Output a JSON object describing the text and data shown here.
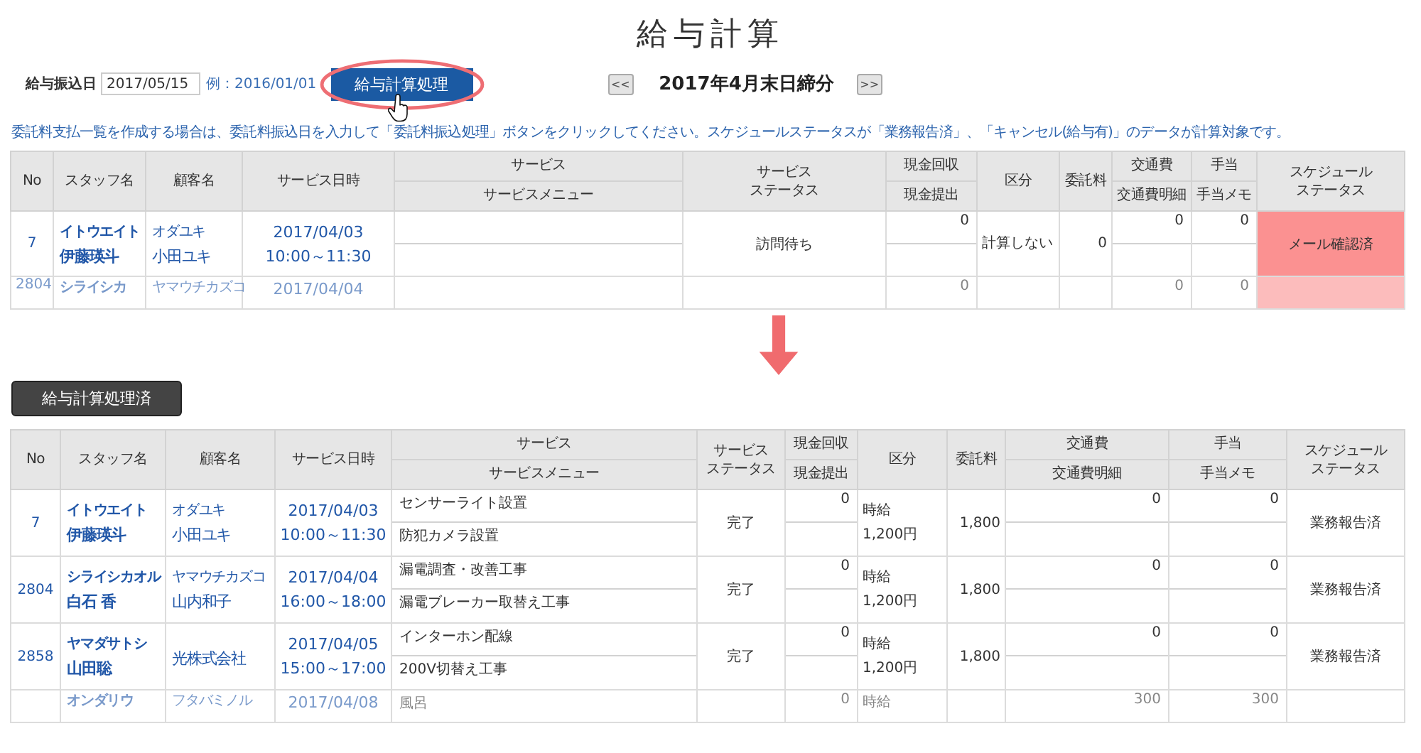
{
  "page_title": "給与計算",
  "payment_date": {
    "label": "給与振込日",
    "value": "2017/05/15",
    "hint": "例：2016/01/01"
  },
  "process_button": {
    "label": "給与計算処理",
    "highlighted": true
  },
  "period": {
    "prev": "<<",
    "label": "2017年4月末日締分",
    "next": ">>"
  },
  "notice": "委託料支払一覧を作成する場合は、委託料振込日を入力して「委託料振込処理」ボタンをクリックしてください。スケジュールステータスが「業務報告済」、「キャンセル(給与有)」のデータが計算対象です。",
  "before_table": {
    "columns": [
      {
        "lines": [
          "No"
        ]
      },
      {
        "lines": [
          "スタッフ名"
        ]
      },
      {
        "lines": [
          "顧客名"
        ]
      },
      {
        "lines": [
          "サービス日時"
        ]
      },
      {
        "label": "サービス",
        "sub": "サービスメニュー"
      },
      {
        "lines": [
          "サービス",
          "ステータス"
        ]
      },
      {
        "label": "現金回収",
        "sub": "現金提出"
      },
      {
        "lines": [
          "区分"
        ]
      },
      {
        "lines": [
          "委託料"
        ]
      },
      {
        "label": "交通費",
        "sub": "交通費明細"
      },
      {
        "label": "手当",
        "sub": "手当メモ"
      },
      {
        "lines": [
          "スケジュール",
          "ステータス"
        ]
      }
    ],
    "rows": [
      {
        "no": "7",
        "staff_kana": "イトウエイト",
        "staff_name": "伊藤瑛斗",
        "customer_kana": "オダユキ",
        "customer_name": "小田ユキ",
        "date": "2017/04/03",
        "time": "10:00～11:30",
        "menu": [],
        "service_status": "訪問待ち",
        "cash": "0",
        "category": [
          "計算しない"
        ],
        "fee": "0",
        "travel": "0",
        "allowance": "0",
        "schedule_status": "メール確認済",
        "schedule_alert": true,
        "faded": false
      },
      {
        "no": "2804",
        "staff_kana": "シライシカ",
        "customer_kana": "ヤマウチカズコ",
        "date": "2017/04/04",
        "menu": [],
        "cash": "0",
        "category": [],
        "travel": "0",
        "allowance": "0",
        "schedule_alert": true,
        "faded": true
      }
    ]
  },
  "processed_button": {
    "label": "給与計算処理済"
  },
  "after_table": {
    "columns": [
      {
        "lines": [
          "No"
        ]
      },
      {
        "lines": [
          "スタッフ名"
        ]
      },
      {
        "lines": [
          "顧客名"
        ]
      },
      {
        "lines": [
          "サービス日時"
        ]
      },
      {
        "label": "サービス",
        "sub": "サービスメニュー"
      },
      {
        "lines": [
          "サービス",
          "ステータス"
        ]
      },
      {
        "label": "現金回収",
        "sub": "現金提出"
      },
      {
        "lines": [
          "区分"
        ]
      },
      {
        "lines": [
          "委託料"
        ]
      },
      {
        "label": "交通費",
        "sub": "交通費明細"
      },
      {
        "label": "手当",
        "sub": "手当メモ"
      },
      {
        "lines": [
          "スケジュール",
          "ステータス"
        ]
      }
    ],
    "rows": [
      {
        "no": "7",
        "staff_kana": "イトウエイト",
        "staff_name": "伊藤瑛斗",
        "customer_kana": "オダユキ",
        "customer_name": "小田ユキ",
        "date": "2017/04/03",
        "time": "10:00～11:30",
        "menu": [
          "センサーライト設置",
          "防犯カメラ設置"
        ],
        "service_status": "完了",
        "cash": "0",
        "category": [
          "時給",
          "1,200円"
        ],
        "fee": "1,800",
        "travel": "0",
        "allowance": "0",
        "schedule_status": "業務報告済",
        "schedule_alert": false,
        "faded": false
      },
      {
        "no": "2804",
        "staff_kana": "シライシカオル",
        "staff_name": "白石 香",
        "customer_kana": "ヤマウチカズコ",
        "customer_name": "山内和子",
        "date": "2017/04/04",
        "time": "16:00～18:00",
        "menu": [
          "漏電調査・改善工事",
          "漏電ブレーカー取替え工事"
        ],
        "service_status": "完了",
        "cash": "0",
        "category": [
          "時給",
          "1,200円"
        ],
        "fee": "1,800",
        "travel": "0",
        "allowance": "0",
        "schedule_status": "業務報告済",
        "schedule_alert": false,
        "faded": false
      },
      {
        "no": "2858",
        "staff_kana": "ヤマダサトシ",
        "staff_name": "山田聡",
        "customer_name": "光株式会社",
        "date": "2017/04/05",
        "time": "15:00～17:00",
        "menu": [
          "インターホン配線",
          "200V切替え工事"
        ],
        "service_status": "完了",
        "cash": "0",
        "category": [
          "時給",
          "1,200円"
        ],
        "fee": "1,800",
        "travel": "0",
        "allowance": "0",
        "schedule_status": "業務報告済",
        "schedule_alert": false,
        "faded": false
      },
      {
        "staff_kana": "オンダリウ",
        "customer_kana": "フタバミノル",
        "date": "2017/04/08",
        "menu": [
          "風呂"
        ],
        "cash": "0",
        "category": [
          "時給"
        ],
        "travel": "300",
        "allowance": "300",
        "schedule_alert": false,
        "faded": true
      }
    ]
  }
}
